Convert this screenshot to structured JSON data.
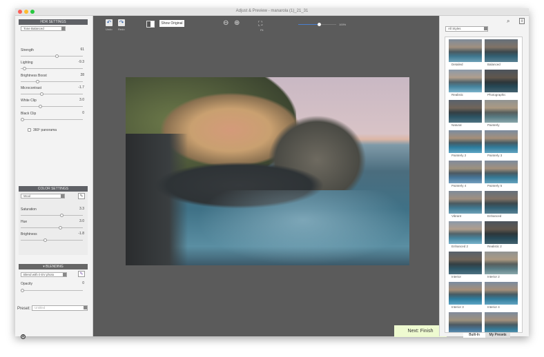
{
  "window": {
    "title": "Adjust & Preview - manarola (1)_21_31",
    "traffic_colors": [
      "#fc5f57",
      "#fdbc2e",
      "#28c840"
    ]
  },
  "hdr_settings": {
    "title": "HDR SETTINGS",
    "preset": "Tone Balanced",
    "sliders": [
      {
        "label": "Strength",
        "value": "61",
        "pos": 0.58
      },
      {
        "label": "Lighting",
        "value": "-9.3",
        "pos": 0.03
      },
      {
        "label": "Brightness Boost",
        "value": "28",
        "pos": 0.25
      },
      {
        "label": "Microcontrast",
        "value": "-1.7",
        "pos": 0.32
      },
      {
        "label": "White Clip",
        "value": "3.0",
        "pos": 0.3
      },
      {
        "label": "Black Clip",
        "value": "0",
        "pos": 0.0
      }
    ],
    "panorama_label": "360º panorama"
  },
  "color_settings": {
    "title": "COLOR SETTINGS",
    "preset": "Wool",
    "sliders": [
      {
        "label": "Saturation",
        "value": "3.3",
        "pos": 0.66
      },
      {
        "label": "Hue",
        "value": "3.0",
        "pos": 0.64
      },
      {
        "label": "Brightness",
        "value": "-1.8",
        "pos": 0.38
      }
    ]
  },
  "blending": {
    "title": "▾ BLENDING",
    "mode": "Blend with 0 EV photo",
    "opacity_label": "Opacity",
    "opacity_value": "0",
    "opacity_pos": 0.0
  },
  "preset": {
    "label": "Preset:",
    "value": "Untitled"
  },
  "toolbar": {
    "undo": "Undo",
    "redo": "Redo",
    "show_original": "Show Original",
    "fit": "Fit",
    "zoom_value": "100%",
    "zoom_pos": 0.55
  },
  "next_button": "Next: Finish",
  "styles": {
    "filter": "All Styles",
    "items": [
      "Detailed",
      "Balanced",
      "Realistic",
      "Photographic",
      "Natural",
      "Painterly",
      "Painterly 2",
      "Painterly 3",
      "Painterly 4",
      "Painterly 5",
      "Vibrant",
      "Enhanced",
      "Enhanced 2",
      "Realistic 2",
      "Interior",
      "Interior 2",
      "Interior 3",
      "Interior 4",
      "",
      ""
    ],
    "tabs": [
      "Built-In",
      "My Presets"
    ]
  }
}
